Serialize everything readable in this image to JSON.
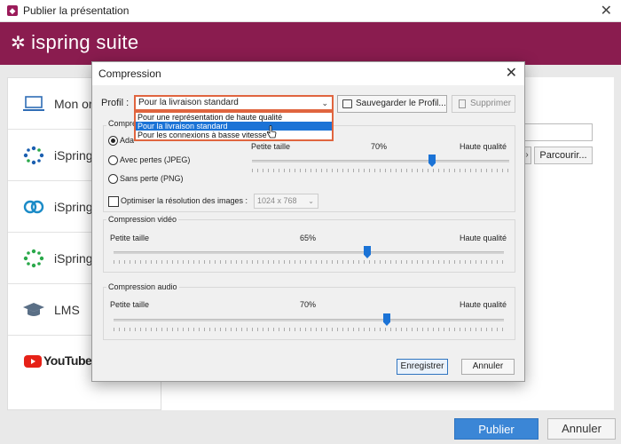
{
  "window": {
    "title": "Publier la présentation",
    "close": "✕"
  },
  "brand": {
    "logo_text": "ispring suite"
  },
  "sidebar": {
    "items": [
      {
        "label": "Mon or",
        "icon": "laptop-icon"
      },
      {
        "label": "iSpring",
        "icon": "ispring-cloud-icon"
      },
      {
        "label": "iSpring",
        "icon": "ispring-space-icon"
      },
      {
        "label": "iSpring",
        "icon": "ispring-learn-icon"
      },
      {
        "label": "LMS",
        "icon": "graduation-cap-icon"
      },
      {
        "label": "YouTube",
        "icon": "youtube-icon"
      }
    ]
  },
  "right": {
    "browse_label": "Parcourir...",
    "arrow": "›"
  },
  "footer": {
    "publish_label": "Publier",
    "cancel_label": "Annuler"
  },
  "dialog": {
    "title": "Compression",
    "close": "✕",
    "profile_label": "Profil :",
    "profile_selected": "Pour la livraison standard",
    "profile_options": [
      "Pour une représentation de haute qualité",
      "Pour la livraison standard",
      "Pour les connexions à basse vitesse"
    ],
    "save_profile_label": "Sauvegarder le Profil...",
    "delete_label": "Supprimer",
    "image_group": {
      "legend": "Compre",
      "radio_adaptive": "Ada",
      "radio_lossy": "Avec pertes (JPEG)",
      "radio_lossless": "Sans perte (PNG)",
      "slider_min": "Petite taille",
      "slider_value": "70%",
      "slider_max": "Haute qualité",
      "slider_fraction": 0.7,
      "optimize_label": "Optimiser la résolution des images :",
      "resolution_value": "1024 x 768"
    },
    "video_group": {
      "legend": "Compression vidéo",
      "slider_min": "Petite taille",
      "slider_value": "65%",
      "slider_max": "Haute qualité",
      "slider_fraction": 0.65
    },
    "audio_group": {
      "legend": "Compression audio",
      "slider_min": "Petite taille",
      "slider_value": "70%",
      "slider_max": "Haute qualité",
      "slider_fraction": 0.7
    },
    "save_label": "Enregistrer",
    "cancel_label": "Annuler"
  },
  "colors": {
    "brand": "#8a1c4f",
    "accent": "#1b73d6",
    "highlight": "#e0653f"
  }
}
